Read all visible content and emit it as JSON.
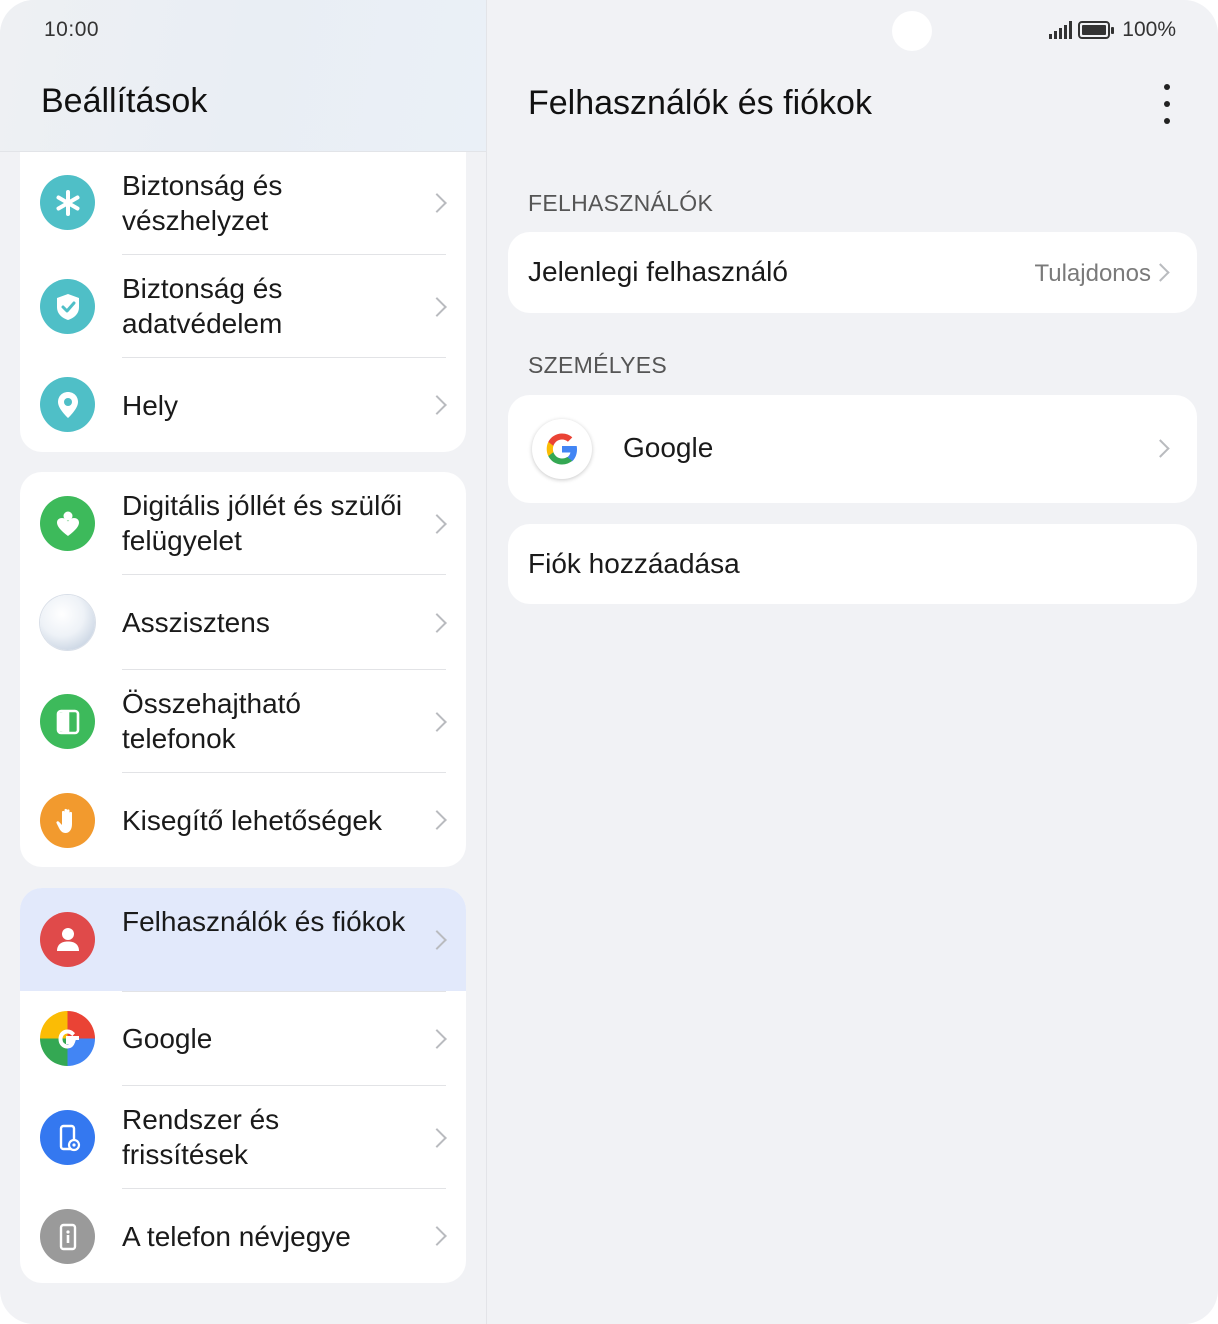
{
  "status": {
    "time": "10:00",
    "battery": "100%"
  },
  "left": {
    "title": "Beállítások",
    "groups": [
      [
        {
          "label": "Biztonság és vészhelyzet",
          "icon": "asterisk-icon",
          "color": "#4fbfc7"
        },
        {
          "label": "Biztonság és adatvédelem",
          "icon": "shield-check-icon",
          "color": "#4fbfc7"
        },
        {
          "label": "Hely",
          "icon": "location-pin-icon",
          "color": "#4fbfc7"
        }
      ],
      [
        {
          "label": "Digitális jóllét és szülői felügyelet",
          "icon": "heart-person-icon",
          "color": "#3dba5b"
        },
        {
          "label": "Asszisztens",
          "icon": "assistant-orb-icon",
          "color": "#dfe6ef"
        },
        {
          "label": "Összehajtható telefonok",
          "icon": "foldable-phone-icon",
          "color": "#3dba5b"
        },
        {
          "label": "Kisegítő lehetőségek",
          "icon": "hand-icon",
          "color": "#f29a2e"
        }
      ],
      [
        {
          "label": "Felhasználók és fiókok",
          "icon": "person-icon",
          "color": "#e04a4a",
          "active": true
        },
        {
          "label": "Google",
          "icon": "google-icon",
          "color": "#ffffff"
        },
        {
          "label": "Rendszer és frissítések",
          "icon": "phone-settings-icon",
          "color": "#3478f0"
        },
        {
          "label": "A telefon névjegye",
          "icon": "phone-info-icon",
          "color": "#9a9a9a"
        }
      ]
    ]
  },
  "right": {
    "title": "Felhasználók és fiókok",
    "users_section": "FELHASZNÁLÓK",
    "current_user_label": "Jelenlegi felhasználó",
    "current_user_value": "Tulajdonos",
    "personal_section": "SZEMÉLYES",
    "google_label": "Google",
    "add_account": "Fiók hozzáadása"
  },
  "colors": {
    "accent": "#2a6ad6",
    "active_row": "#e2e9fb"
  }
}
